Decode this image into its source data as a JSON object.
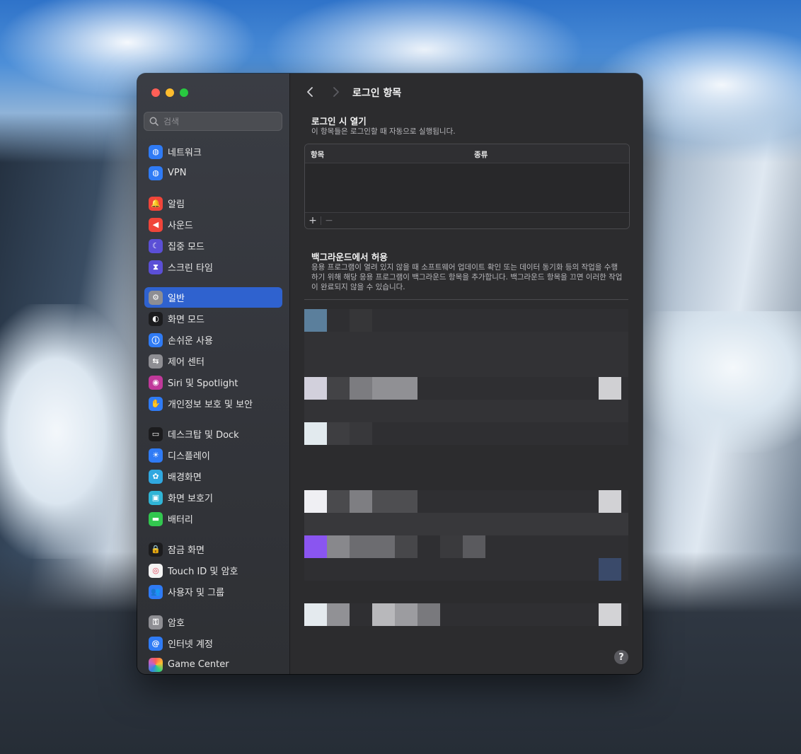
{
  "colors": {
    "accent": "#2f62cf",
    "window_bg": "#2c2c2e",
    "sidebar_bg": "#36383e"
  },
  "window": {
    "traffic_lights": [
      "close",
      "minimize",
      "zoom"
    ]
  },
  "sidebar": {
    "search_placeholder": "검색",
    "items": [
      {
        "label": "네트워크",
        "icon": "globe-icon",
        "color": "#2f7bf5"
      },
      {
        "label": "VPN",
        "icon": "vpn-globe-icon",
        "color": "#2f7bf5"
      },
      {
        "label": "알림",
        "icon": "bell-icon",
        "color": "#f0453a"
      },
      {
        "label": "사운드",
        "icon": "speaker-icon",
        "color": "#f0453a"
      },
      {
        "label": "집중 모드",
        "icon": "moon-icon",
        "color": "#5b4fd6"
      },
      {
        "label": "스크린 타임",
        "icon": "hourglass-icon",
        "color": "#5b4fd6"
      },
      {
        "label": "일반",
        "icon": "gear-icon",
        "color": "#8e8e93",
        "active": true
      },
      {
        "label": "화면 모드",
        "icon": "appearance-icon",
        "color": "#1c1c1e"
      },
      {
        "label": "손쉬운 사용",
        "icon": "accessibility-icon",
        "color": "#2f7bf5"
      },
      {
        "label": "제어 센터",
        "icon": "toggles-icon",
        "color": "#8e8e93"
      },
      {
        "label": "Siri 및 Spotlight",
        "icon": "siri-icon",
        "color": "#c0399a"
      },
      {
        "label": "개인정보 보호 및 보안",
        "icon": "hand-icon",
        "color": "#2f7bf5"
      },
      {
        "label": "데스크탑 및 Dock",
        "icon": "dock-icon",
        "color": "#1c1c1e"
      },
      {
        "label": "디스플레이",
        "icon": "sun-icon",
        "color": "#2f7bf5"
      },
      {
        "label": "배경화면",
        "icon": "flower-icon",
        "color": "#30a8e0"
      },
      {
        "label": "화면 보호기",
        "icon": "screensaver-icon",
        "color": "#30b5d6"
      },
      {
        "label": "배터리",
        "icon": "battery-icon",
        "color": "#32c74f"
      },
      {
        "label": "잠금 화면",
        "icon": "lock-icon",
        "color": "#1c1c1e"
      },
      {
        "label": "Touch ID 및 암호",
        "icon": "fingerprint-icon",
        "color": "#f2f2f2"
      },
      {
        "label": "사용자 및 그룹",
        "icon": "users-icon",
        "color": "#2f7bf5"
      },
      {
        "label": "암호",
        "icon": "key-icon",
        "color": "#8e8e93"
      },
      {
        "label": "인터넷 계정",
        "icon": "at-icon",
        "color": "#2f7bf5"
      },
      {
        "label": "Game Center",
        "icon": "gamecenter-icon",
        "color": "#f2f2f2"
      }
    ]
  },
  "main": {
    "title": "로그인 항목",
    "login_section": {
      "title": "로그인 시 열기",
      "description": "이 항목들은 로그인할 때 자동으로 실행됩니다.",
      "columns": [
        "항목",
        "종류"
      ],
      "add_label": "+",
      "remove_label": "−"
    },
    "background_section": {
      "title": "백그라운드에서 허용",
      "description": "응용 프로그램이 열려 있지 않을 때 소프트웨어 업데이트 확인 또는 데이터 동기화 등의 작업을 수행하기 위해 해당 응용 프로그램이 백그라운드 항목을 추가합니다. 백그라운드 항목을 끄면 이러한 작업이 완료되지 않을 수 있습니다."
    },
    "help_label": "?"
  }
}
